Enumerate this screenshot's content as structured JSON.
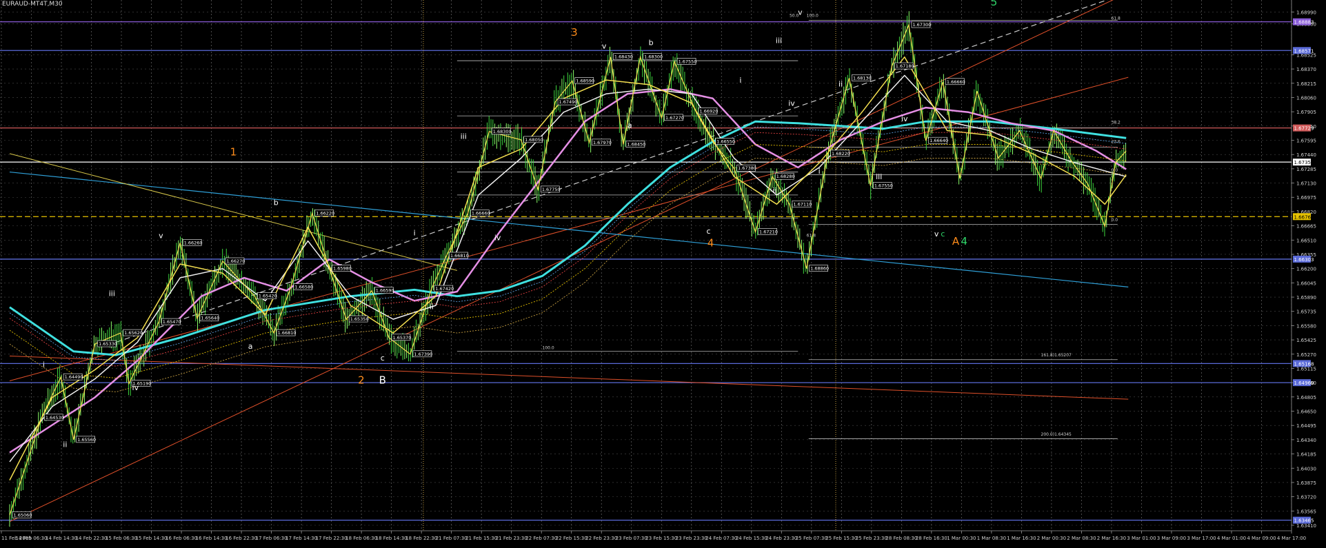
{
  "window_title": "EURAUD-MT4T,M30",
  "chart_data": {
    "type": "line",
    "title": "EURAUD-MT4T,M30",
    "ylim": [
      1.6335,
      1.6912
    ],
    "x_ticks": [
      "11 Feb 2005",
      "14 Feb 06:30",
      "14 Feb 14:30",
      "14 Feb 22:30",
      "15 Feb 06:30",
      "15 Feb 14:30",
      "16 Feb 06:30",
      "16 Feb 14:30",
      "16 Feb 22:30",
      "17 Feb 06:30",
      "17 Feb 14:30",
      "17 Feb 22:30",
      "18 Feb 06:30",
      "18 Feb 14:30",
      "18 Feb 22:30",
      "21 Feb 07:30",
      "21 Feb 15:30",
      "21 Feb 23:30",
      "22 Feb 07:30",
      "22 Feb 15:30",
      "22 Feb 23:30",
      "23 Feb 07:30",
      "23 Feb 15:30",
      "23 Feb 23:30",
      "24 Feb 07:30",
      "24 Feb 15:30",
      "24 Feb 23:30",
      "25 Feb 07:30",
      "25 Feb 15:30",
      "25 Feb 23:30",
      "28 Feb 08:30",
      "28 Feb 16:30",
      "1 Mar 00:30",
      "1 Mar 08:30",
      "1 Mar 16:30",
      "2 Mar 00:30",
      "2 Mar 08:30",
      "2 Mar 16:30",
      "3 Mar 01:00",
      "3 Mar 09:00",
      "3 Mar 17:00",
      "4 Mar 01:00",
      "4 Mar 09:00",
      "4 Mar 17:00"
    ],
    "y_ticks": [
      "1.68990",
      "1.68860",
      "1.68525",
      "1.68370",
      "1.68215",
      "1.68060",
      "1.67905",
      "1.67750",
      "1.67595",
      "1.67440",
      "1.67285",
      "1.67130",
      "1.66975",
      "1.66820",
      "1.66665",
      "1.66510",
      "1.66355",
      "1.66200",
      "1.66045",
      "1.65890",
      "1.65735",
      "1.65580",
      "1.65425",
      "1.65270",
      "1.65115",
      "1.64960",
      "1.64805",
      "1.64650",
      "1.64495",
      "1.64340",
      "1.64185",
      "1.64030",
      "1.63875",
      "1.63720",
      "1.63565",
      "1.63410"
    ],
    "y_badges": [
      {
        "label": "1.68883",
        "value": 1.68883,
        "color": "#8a5cd8"
      },
      {
        "label": "1.68571",
        "value": 1.68571,
        "color": "#5a6ad8"
      },
      {
        "label": "1.67729",
        "value": 1.67729,
        "color": "#d05a5a"
      },
      {
        "label": "1.67358",
        "value": 1.67358,
        "color": "#ffffff"
      },
      {
        "label": "1.66765",
        "value": 1.66765,
        "color": "#e6c200"
      },
      {
        "label": "1.66303",
        "value": 1.66303,
        "color": "#5a6ad8"
      },
      {
        "label": "1.65168",
        "value": 1.65168,
        "color": "#5a6ad8"
      },
      {
        "label": "1.64960",
        "value": 1.6496,
        "color": "#5a6ad8"
      },
      {
        "label": "1.63465",
        "value": 1.63465,
        "color": "#5a6ad8"
      }
    ],
    "price_points": [
      {
        "x": 0,
        "y": 1.6352
      },
      {
        "x": 1.5,
        "y": 1.6458
      },
      {
        "x": 2.4,
        "y": 1.6502
      },
      {
        "x": 3,
        "y": 1.6434
      },
      {
        "x": 4,
        "y": 1.6538
      },
      {
        "x": 5.2,
        "y": 1.655
      },
      {
        "x": 5.6,
        "y": 1.6495
      },
      {
        "x": 7,
        "y": 1.6562
      },
      {
        "x": 8,
        "y": 1.6648
      },
      {
        "x": 8.8,
        "y": 1.6566
      },
      {
        "x": 10,
        "y": 1.6628
      },
      {
        "x": 11.5,
        "y": 1.659
      },
      {
        "x": 12.4,
        "y": 1.655
      },
      {
        "x": 13.2,
        "y": 1.66
      },
      {
        "x": 14.2,
        "y": 1.668
      },
      {
        "x": 15,
        "y": 1.662
      },
      {
        "x": 15.8,
        "y": 1.6565
      },
      {
        "x": 17,
        "y": 1.6596
      },
      {
        "x": 17.8,
        "y": 1.6545
      },
      {
        "x": 18.8,
        "y": 1.6527
      },
      {
        "x": 19.8,
        "y": 1.6598
      },
      {
        "x": 20.5,
        "y": 1.6634
      },
      {
        "x": 21.5,
        "y": 1.668
      },
      {
        "x": 22.5,
        "y": 1.6769
      },
      {
        "x": 24,
        "y": 1.676
      },
      {
        "x": 24.8,
        "y": 1.6706
      },
      {
        "x": 25.6,
        "y": 1.6801
      },
      {
        "x": 26.4,
        "y": 1.6824
      },
      {
        "x": 27.2,
        "y": 1.6757
      },
      {
        "x": 28.2,
        "y": 1.685
      },
      {
        "x": 28.8,
        "y": 1.6755
      },
      {
        "x": 29.6,
        "y": 1.685
      },
      {
        "x": 30.6,
        "y": 1.6784
      },
      {
        "x": 31.2,
        "y": 1.6845
      },
      {
        "x": 32.2,
        "y": 1.6791
      },
      {
        "x": 33,
        "y": 1.6758
      },
      {
        "x": 34,
        "y": 1.6729
      },
      {
        "x": 35,
        "y": 1.666
      },
      {
        "x": 35.8,
        "y": 1.672
      },
      {
        "x": 36.6,
        "y": 1.669
      },
      {
        "x": 37.4,
        "y": 1.662
      },
      {
        "x": 38.4,
        "y": 1.6745
      },
      {
        "x": 39.4,
        "y": 1.6827
      },
      {
        "x": 40.4,
        "y": 1.671
      },
      {
        "x": 41.4,
        "y": 1.684
      },
      {
        "x": 42.2,
        "y": 1.6885
      },
      {
        "x": 43,
        "y": 1.6759
      },
      {
        "x": 43.8,
        "y": 1.6823
      },
      {
        "x": 44.6,
        "y": 1.6718
      },
      {
        "x": 45.4,
        "y": 1.6813
      },
      {
        "x": 46.4,
        "y": 1.674
      },
      {
        "x": 47.4,
        "y": 1.677
      },
      {
        "x": 48.4,
        "y": 1.6718
      },
      {
        "x": 49,
        "y": 1.677
      },
      {
        "x": 49.8,
        "y": 1.6738
      },
      {
        "x": 50.6,
        "y": 1.6712
      },
      {
        "x": 51.4,
        "y": 1.6666
      },
      {
        "x": 51.9,
        "y": 1.6735
      },
      {
        "x": 52.4,
        "y": 1.6748
      }
    ],
    "ma_series": [
      {
        "color": "#3fe0e0",
        "width": 3,
        "points": [
          {
            "x": 0,
            "y": 1.6578
          },
          {
            "x": 3,
            "y": 1.653
          },
          {
            "x": 5,
            "y": 1.6526
          },
          {
            "x": 8,
            "y": 1.6545
          },
          {
            "x": 12,
            "y": 1.6575
          },
          {
            "x": 16,
            "y": 1.659
          },
          {
            "x": 19,
            "y": 1.6597
          },
          {
            "x": 21,
            "y": 1.659
          },
          {
            "x": 23,
            "y": 1.6596
          },
          {
            "x": 25,
            "y": 1.6612
          },
          {
            "x": 27,
            "y": 1.6645
          },
          {
            "x": 29,
            "y": 1.669
          },
          {
            "x": 31,
            "y": 1.673
          },
          {
            "x": 33,
            "y": 1.6758
          },
          {
            "x": 35,
            "y": 1.678
          },
          {
            "x": 37,
            "y": 1.6778
          },
          {
            "x": 39,
            "y": 1.6775
          },
          {
            "x": 41,
            "y": 1.6772
          },
          {
            "x": 43,
            "y": 1.678
          },
          {
            "x": 46,
            "y": 1.678
          },
          {
            "x": 49,
            "y": 1.6772
          },
          {
            "x": 52.4,
            "y": 1.6762
          }
        ]
      },
      {
        "color": "#e58fe5",
        "width": 2.5,
        "points": [
          {
            "x": 0,
            "y": 1.642
          },
          {
            "x": 2,
            "y": 1.645
          },
          {
            "x": 4,
            "y": 1.648
          },
          {
            "x": 6,
            "y": 1.652
          },
          {
            "x": 9,
            "y": 1.659
          },
          {
            "x": 11,
            "y": 1.661
          },
          {
            "x": 13,
            "y": 1.6596
          },
          {
            "x": 15,
            "y": 1.663
          },
          {
            "x": 17,
            "y": 1.6605
          },
          {
            "x": 19,
            "y": 1.6585
          },
          {
            "x": 21,
            "y": 1.6595
          },
          {
            "x": 23,
            "y": 1.666
          },
          {
            "x": 25,
            "y": 1.672
          },
          {
            "x": 27,
            "y": 1.678
          },
          {
            "x": 29,
            "y": 1.681
          },
          {
            "x": 31,
            "y": 1.6815
          },
          {
            "x": 33,
            "y": 1.6805
          },
          {
            "x": 35,
            "y": 1.6755
          },
          {
            "x": 37,
            "y": 1.673
          },
          {
            "x": 39,
            "y": 1.676
          },
          {
            "x": 41,
            "y": 1.678
          },
          {
            "x": 43,
            "y": 1.6795
          },
          {
            "x": 45,
            "y": 1.679
          },
          {
            "x": 47,
            "y": 1.6778
          },
          {
            "x": 49,
            "y": 1.677
          },
          {
            "x": 51,
            "y": 1.6748
          },
          {
            "x": 52.4,
            "y": 1.6728
          }
        ]
      },
      {
        "color": "#f0f0f0",
        "width": 1.5,
        "points": [
          {
            "x": 0,
            "y": 1.641
          },
          {
            "x": 2,
            "y": 1.647
          },
          {
            "x": 4,
            "y": 1.65
          },
          {
            "x": 6,
            "y": 1.654
          },
          {
            "x": 8,
            "y": 1.661
          },
          {
            "x": 10,
            "y": 1.662
          },
          {
            "x": 12,
            "y": 1.6585
          },
          {
            "x": 14,
            "y": 1.665
          },
          {
            "x": 16,
            "y": 1.659
          },
          {
            "x": 18,
            "y": 1.6565
          },
          {
            "x": 20,
            "y": 1.658
          },
          {
            "x": 22,
            "y": 1.67
          },
          {
            "x": 24,
            "y": 1.674
          },
          {
            "x": 26,
            "y": 1.679
          },
          {
            "x": 28,
            "y": 1.681
          },
          {
            "x": 30,
            "y": 1.6815
          },
          {
            "x": 32,
            "y": 1.681
          },
          {
            "x": 34,
            "y": 1.674
          },
          {
            "x": 36,
            "y": 1.67
          },
          {
            "x": 38,
            "y": 1.673
          },
          {
            "x": 40,
            "y": 1.678
          },
          {
            "x": 42,
            "y": 1.683
          },
          {
            "x": 44,
            "y": 1.678
          },
          {
            "x": 46,
            "y": 1.677
          },
          {
            "x": 48,
            "y": 1.675
          },
          {
            "x": 50,
            "y": 1.6735
          },
          {
            "x": 52.4,
            "y": 1.672
          }
        ]
      },
      {
        "color": "#f5e050",
        "width": 1.5,
        "points": [
          {
            "x": 0,
            "y": 1.639
          },
          {
            "x": 2,
            "y": 1.648
          },
          {
            "x": 4,
            "y": 1.651
          },
          {
            "x": 6,
            "y": 1.6545
          },
          {
            "x": 8,
            "y": 1.6625
          },
          {
            "x": 10,
            "y": 1.6615
          },
          {
            "x": 12,
            "y": 1.657
          },
          {
            "x": 14,
            "y": 1.6665
          },
          {
            "x": 16,
            "y": 1.658
          },
          {
            "x": 18,
            "y": 1.655
          },
          {
            "x": 20,
            "y": 1.659
          },
          {
            "x": 22,
            "y": 1.673
          },
          {
            "x": 24,
            "y": 1.675
          },
          {
            "x": 26,
            "y": 1.6805
          },
          {
            "x": 28,
            "y": 1.6825
          },
          {
            "x": 30,
            "y": 1.682
          },
          {
            "x": 32,
            "y": 1.68
          },
          {
            "x": 34,
            "y": 1.672
          },
          {
            "x": 36,
            "y": 1.669
          },
          {
            "x": 38,
            "y": 1.6735
          },
          {
            "x": 40,
            "y": 1.679
          },
          {
            "x": 42,
            "y": 1.685
          },
          {
            "x": 44,
            "y": 1.677
          },
          {
            "x": 46,
            "y": 1.6765
          },
          {
            "x": 48,
            "y": 1.6745
          },
          {
            "x": 50,
            "y": 1.672
          },
          {
            "x": 51.4,
            "y": 1.669
          },
          {
            "x": 52.4,
            "y": 1.6722
          }
        ]
      }
    ],
    "wave_labels": [
      {
        "text": "1",
        "x": 10.5,
        "y": 1.6743,
        "color": "#ff8c1a"
      },
      {
        "text": "2",
        "x": 16.5,
        "y": 1.6495,
        "color": "#ff8c1a"
      },
      {
        "text": "3",
        "x": 26.5,
        "y": 1.6873,
        "color": "#ff8c1a"
      },
      {
        "text": "4",
        "x": 32.9,
        "y": 1.6644,
        "color": "#ff8c1a"
      },
      {
        "text": "5",
        "x": 37.6,
        "y": 1.6912,
        "color": "#ff8c1a"
      },
      {
        "text": "A",
        "x": 44.4,
        "y": 1.6646,
        "color": "#ff8c1a"
      },
      {
        "text": "B",
        "x": 17.5,
        "y": 1.6495,
        "color": "#ffffff"
      },
      {
        "text": "i",
        "x": 1.6,
        "y": 1.6513,
        "color": "#ffffff"
      },
      {
        "text": "ii",
        "x": 2.6,
        "y": 1.6426,
        "color": "#ffffff"
      },
      {
        "text": "iii",
        "x": 4.8,
        "y": 1.659,
        "color": "#ffffff"
      },
      {
        "text": "iv",
        "x": 5.9,
        "y": 1.6488,
        "color": "#ffffff"
      },
      {
        "text": "v",
        "x": 7.1,
        "y": 1.6653,
        "color": "#ffffff"
      },
      {
        "text": "a",
        "x": 11.3,
        "y": 1.6533,
        "color": "#ffffff"
      },
      {
        "text": "b",
        "x": 12.5,
        "y": 1.6689,
        "color": "#ffffff"
      },
      {
        "text": "c",
        "x": 17.5,
        "y": 1.652,
        "color": "#ffffff"
      },
      {
        "text": "i",
        "x": 19,
        "y": 1.6656,
        "color": "#ffffff"
      },
      {
        "text": "ii",
        "x": 19.8,
        "y": 1.6576,
        "color": "#ffffff"
      },
      {
        "text": "iii",
        "x": 21.3,
        "y": 1.6761,
        "color": "#ffffff"
      },
      {
        "text": "iv",
        "x": 22.9,
        "y": 1.6651,
        "color": "#ffffff"
      },
      {
        "text": "v",
        "x": 27.9,
        "y": 1.6859,
        "color": "#ffffff"
      },
      {
        "text": "a",
        "x": 29.1,
        "y": 1.6773,
        "color": "#ffffff"
      },
      {
        "text": "b",
        "x": 30.1,
        "y": 1.6863,
        "color": "#ffffff"
      },
      {
        "text": "c",
        "x": 32.8,
        "y": 1.6658,
        "color": "#ffffff"
      },
      {
        "text": "i",
        "x": 34.3,
        "y": 1.6822,
        "color": "#ffffff"
      },
      {
        "text": "ii",
        "x": 35.9,
        "y": 1.6702,
        "color": "#ffffff"
      },
      {
        "text": "iii",
        "x": 36.1,
        "y": 1.6865,
        "color": "#ffffff"
      },
      {
        "text": "iv",
        "x": 36.7,
        "y": 1.6797,
        "color": "#ffffff"
      },
      {
        "text": "v",
        "x": 37.1,
        "y": 1.6896,
        "color": "#ffffff"
      },
      {
        "text": "i",
        "x": 38,
        "y": 1.6723,
        "color": "#ffffff"
      },
      {
        "text": "ii",
        "x": 39,
        "y": 1.6818,
        "color": "#ffffff"
      },
      {
        "text": "iii",
        "x": 40.8,
        "y": 1.6717,
        "color": "#ffffff"
      },
      {
        "text": "iv",
        "x": 42,
        "y": 1.678,
        "color": "#ffffff"
      },
      {
        "text": "v",
        "x": 43.5,
        "y": 1.6655,
        "color": "#ffffff"
      },
      {
        "text": "4",
        "x": 44.8,
        "y": 1.6646,
        "color": "#2fd86a"
      },
      {
        "text": "5",
        "x": 46.2,
        "y": 1.6906,
        "color": "#2fd86a"
      },
      {
        "text": "c",
        "x": 43.8,
        "y": 1.6655,
        "color": "#2fd86a"
      }
    ],
    "price_boxes": [
      "1.65060",
      "1.64530",
      "1.64490",
      "1.65560",
      "1.65330",
      "1.65620",
      "1.65190",
      "1.65470",
      "1.66260",
      "1.65640",
      "1.66270",
      "1.65420",
      "1.66810",
      "1.66580",
      "1.66220",
      "1.65980",
      "1.65350",
      "1.66590",
      "1.65370",
      "1.67390",
      "1.67420",
      "1.66810",
      "1.66660",
      "1.68300",
      "1.68050",
      "1.67750",
      "1.67490",
      "1.68590",
      "1.67970",
      "1.68430",
      "1.68450",
      "1.68300",
      "1.67270",
      "1.67550",
      "1.66920",
      "1.66550",
      "1.67380",
      "1.67210",
      "1.68280",
      "1.67110",
      "1.68860",
      "1.68220",
      "1.68130",
      "1.67550",
      "1.67180",
      "1.67300",
      "1.66640",
      "1.66660"
    ],
    "fib_labels": [
      "100.0",
      "61.8",
      "50.0",
      "38.2",
      "23.6",
      "0.0",
      "0.0",
      "61.8",
      "100.0",
      "161.8)1.65207",
      "200.0)1.64345"
    ]
  }
}
